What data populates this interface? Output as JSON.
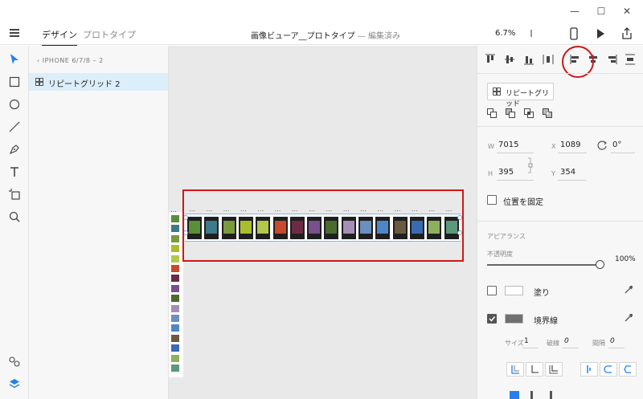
{
  "window": {
    "minimize": "—",
    "maximize": "☐",
    "close": "✕"
  },
  "header": {
    "tabs": [
      {
        "label": "デザイン",
        "active": true
      },
      {
        "label": "プロトタイプ",
        "active": false
      }
    ],
    "title": "画像ビューア__プロトタイプ",
    "title_sep": " — ",
    "status": "編集済み",
    "zoom": "6.7%"
  },
  "layers": {
    "breadcrumb": "IPHONE 6/7/8 – 2",
    "items": [
      {
        "label": "リピートグリッド 2",
        "selected": true
      }
    ]
  },
  "canvas": {
    "artboard_label": "…",
    "cell_marker": "…",
    "cell_count": 16,
    "photo_colors": [
      "#5a8f3a",
      "#3d7a8a",
      "#7a9a3e",
      "#aabd2d",
      "#b0c94a",
      "#c9492c",
      "#6d2a45",
      "#7a4f8e",
      "#4a6b2d",
      "#a58fb8",
      "#6b8fbf",
      "#4f86c9",
      "#6c5a3e",
      "#3a6bb2",
      "#8fb05a",
      "#5a9a7a"
    ]
  },
  "properties": {
    "repeat_grid_label": "リピートグリッド",
    "transform": {
      "w_label": "W",
      "w_value": "7015",
      "h_label": "H",
      "h_value": "395",
      "x_label": "X",
      "x_value": "1089",
      "y_label": "Y",
      "y_value": "354",
      "rotation": "0°"
    },
    "fix_position_label": "位置を固定",
    "appearance_title": "アピアランス",
    "opacity_label": "不透明度",
    "opacity_value": "100%",
    "opacity": 1.0,
    "fill": {
      "label": "塗り",
      "checked": false,
      "color": "#ffffff"
    },
    "border": {
      "label": "境界線",
      "checked": true,
      "color": "#707070",
      "size_label": "サイズ",
      "size_value": "1",
      "dash_label": "破線",
      "dash_value": "0",
      "gap_label": "間隔",
      "gap_value": "0"
    }
  },
  "colors": {
    "accent": "#2680eb",
    "selection": "#dceefa",
    "highlight_red": "#d01818"
  }
}
